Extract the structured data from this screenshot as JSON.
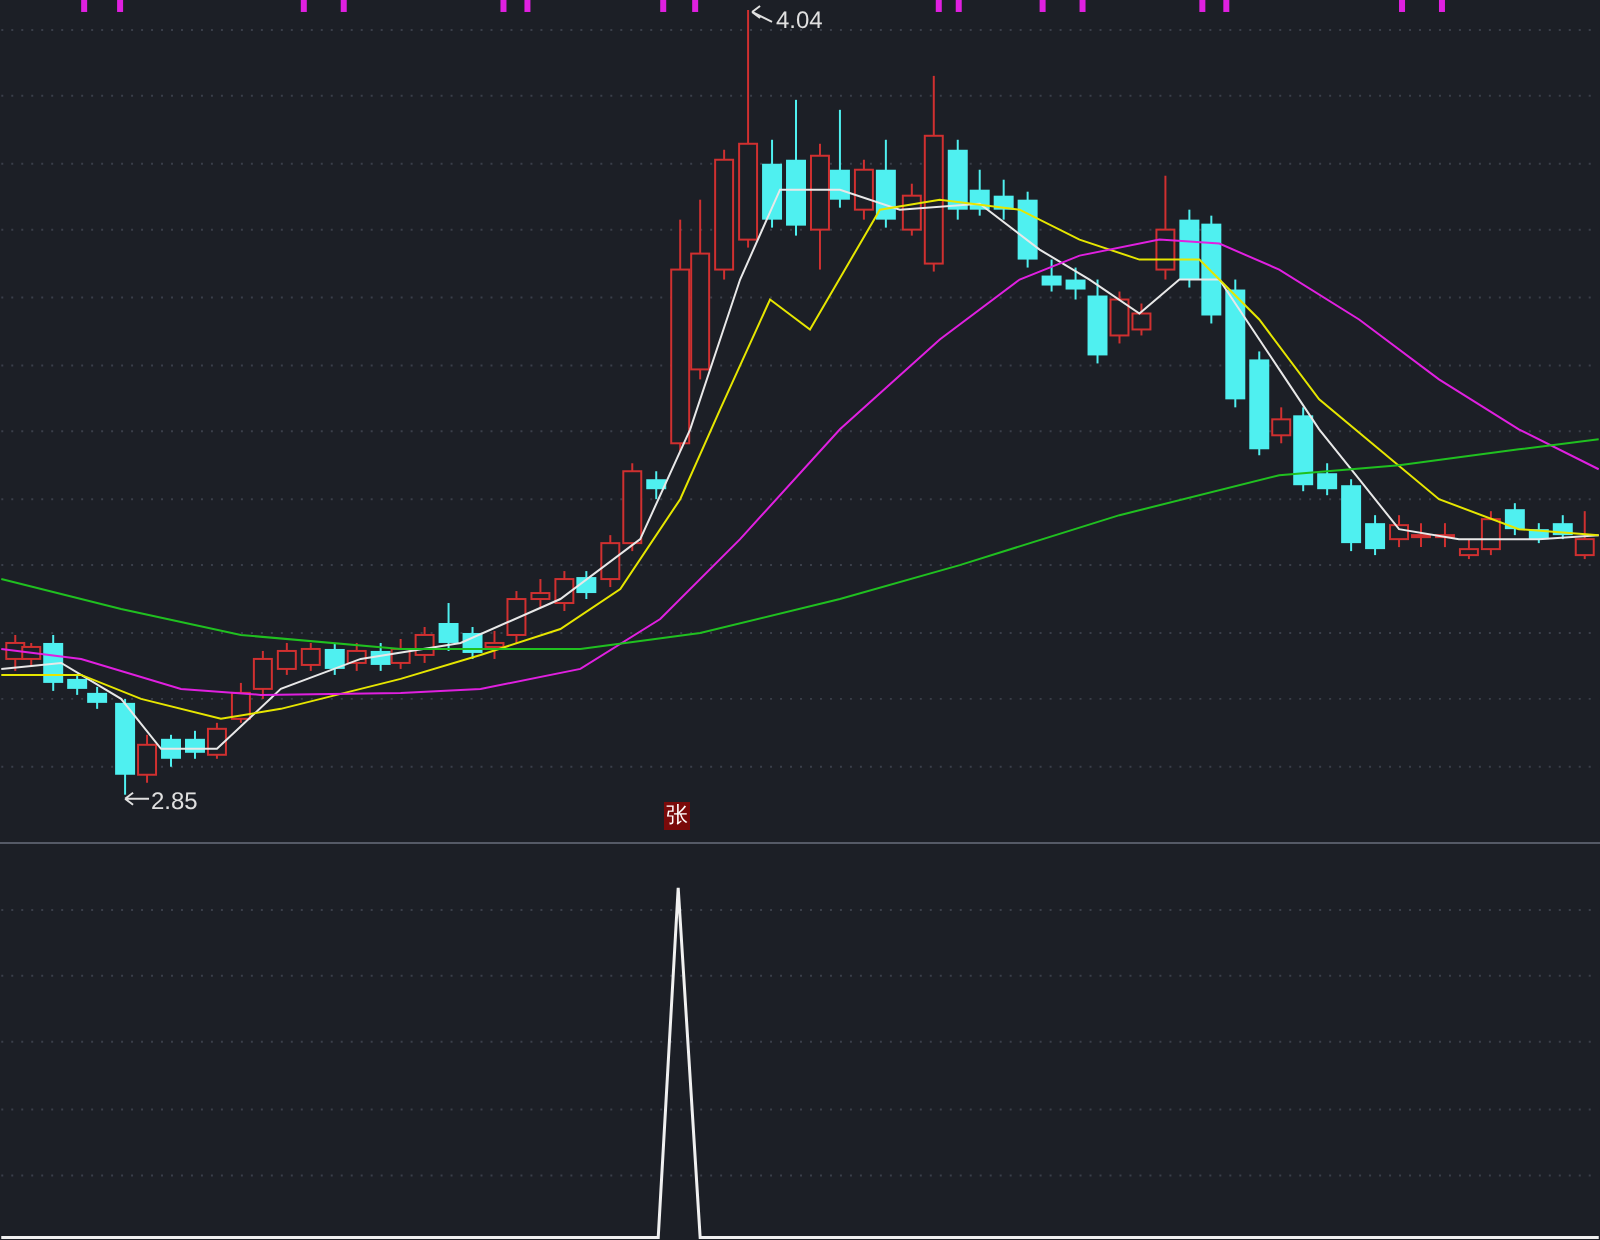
{
  "price_panel": {
    "high_label": "4.04",
    "low_label": "2.85"
  },
  "signal_panel": {
    "marker": "张"
  }
}
